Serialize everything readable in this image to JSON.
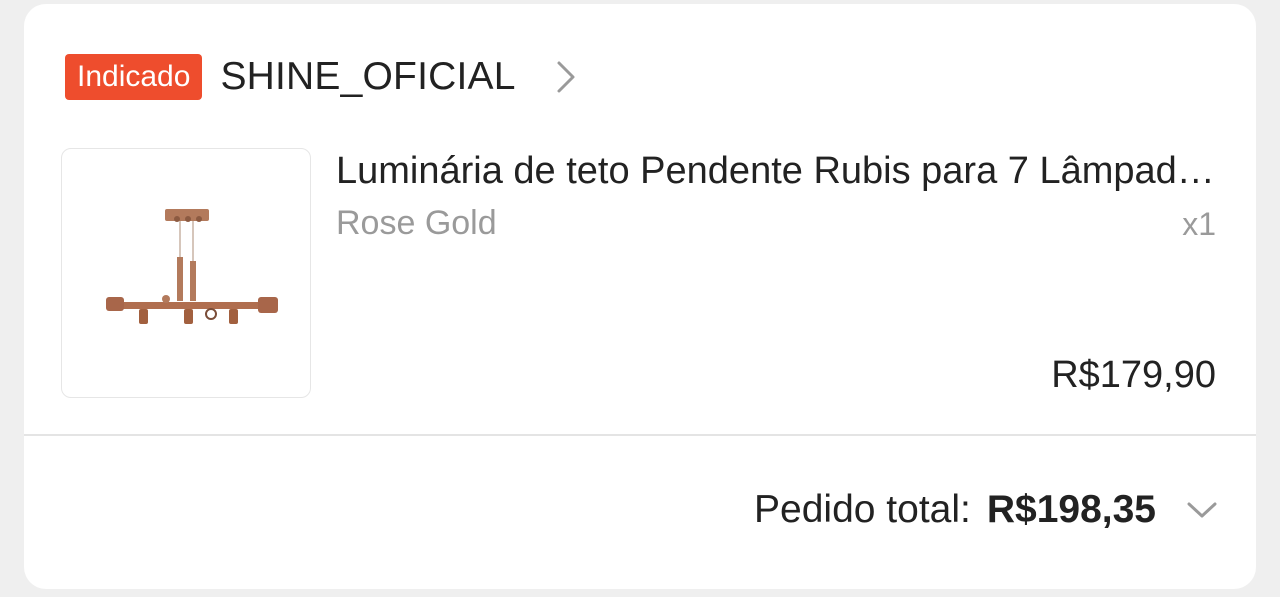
{
  "shop": {
    "badge": "Indicado",
    "name": "SHINE_OFICIAL",
    "chevron_icon": "chevron-right-icon"
  },
  "product": {
    "image_icon": "pendant-lamp-image",
    "title": "Luminária de teto Pendente Rubis para 7 Lâmpadas",
    "variation": "Rose Gold",
    "quantity": "x1",
    "price": "R$179,90"
  },
  "order": {
    "total_label": "Pedido total:",
    "total_value": "R$198,35",
    "expand_icon": "chevron-down-icon"
  },
  "colors": {
    "badge_bg": "#ee4d2d",
    "text_primary": "#222222",
    "text_secondary": "#9a9a9a",
    "card_bg": "#ffffff",
    "page_bg": "#efefef"
  }
}
